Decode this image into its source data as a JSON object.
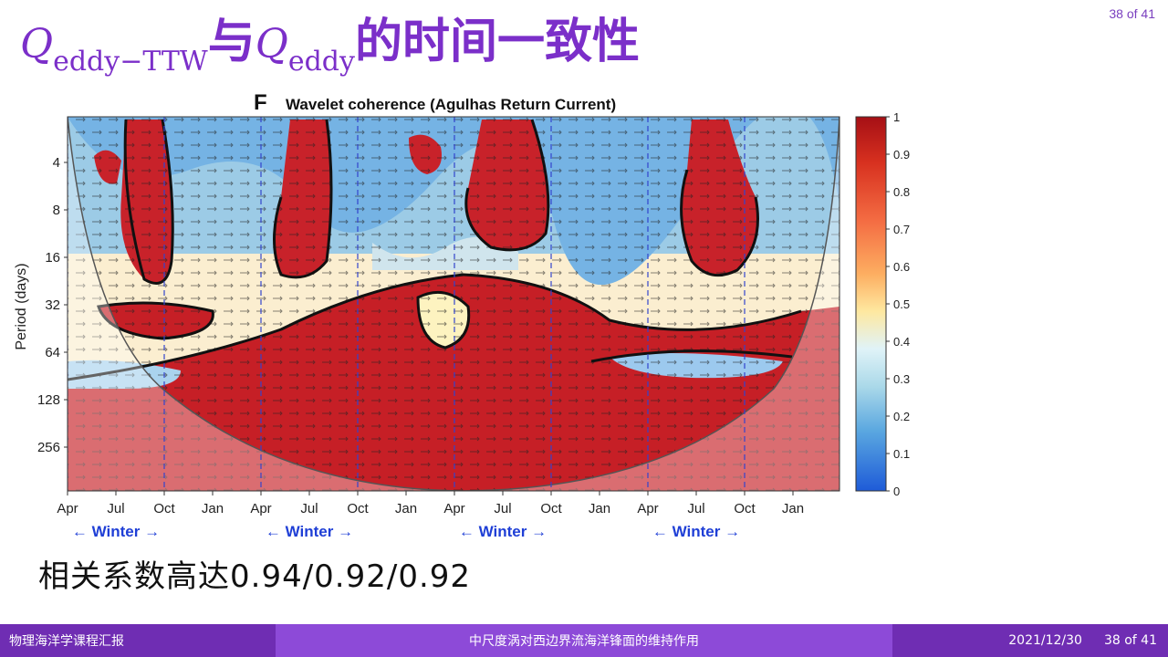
{
  "page_counter": "38 of 41",
  "title": {
    "q": "Q",
    "sub1": "eddy−TTW",
    "mid": "与",
    "q2": "Q",
    "sub2": "eddy",
    "rest": "的时间一致性"
  },
  "figure": {
    "panel_letter": "F",
    "panel_title": "Wavelet coherence (Agulhas Return Current)",
    "ylabel": "Period (days)",
    "y_ticks": [
      "4",
      "8",
      "16",
      "32",
      "64",
      "128",
      "256"
    ],
    "x_ticks": [
      "Apr",
      "Jul",
      "Oct",
      "Jan",
      "Apr",
      "Jul",
      "Oct",
      "Jan",
      "Apr",
      "Jul",
      "Oct",
      "Jan",
      "Apr",
      "Jul",
      "Oct",
      "Jan"
    ],
    "winter_labels": [
      "← Winter →",
      "← Winter →",
      "← Winter →",
      "← Winter →"
    ],
    "colorbar_ticks": [
      "1",
      "0.9",
      "0.8",
      "0.7",
      "0.6",
      "0.5",
      "0.4",
      "0.3",
      "0.2",
      "0.1",
      "0"
    ],
    "colors": {
      "high": "#b5121b",
      "mid": "#f7f0b0",
      "low": "#1e6fd9"
    }
  },
  "caption": "相关系数高达0.94/0.92/0.92",
  "footer": {
    "left": "物理海洋学课程汇报",
    "center": "中尺度涡对西边界流海洋锋面的维持作用",
    "date": "2021/12/30",
    "page": "38 of 41"
  }
}
